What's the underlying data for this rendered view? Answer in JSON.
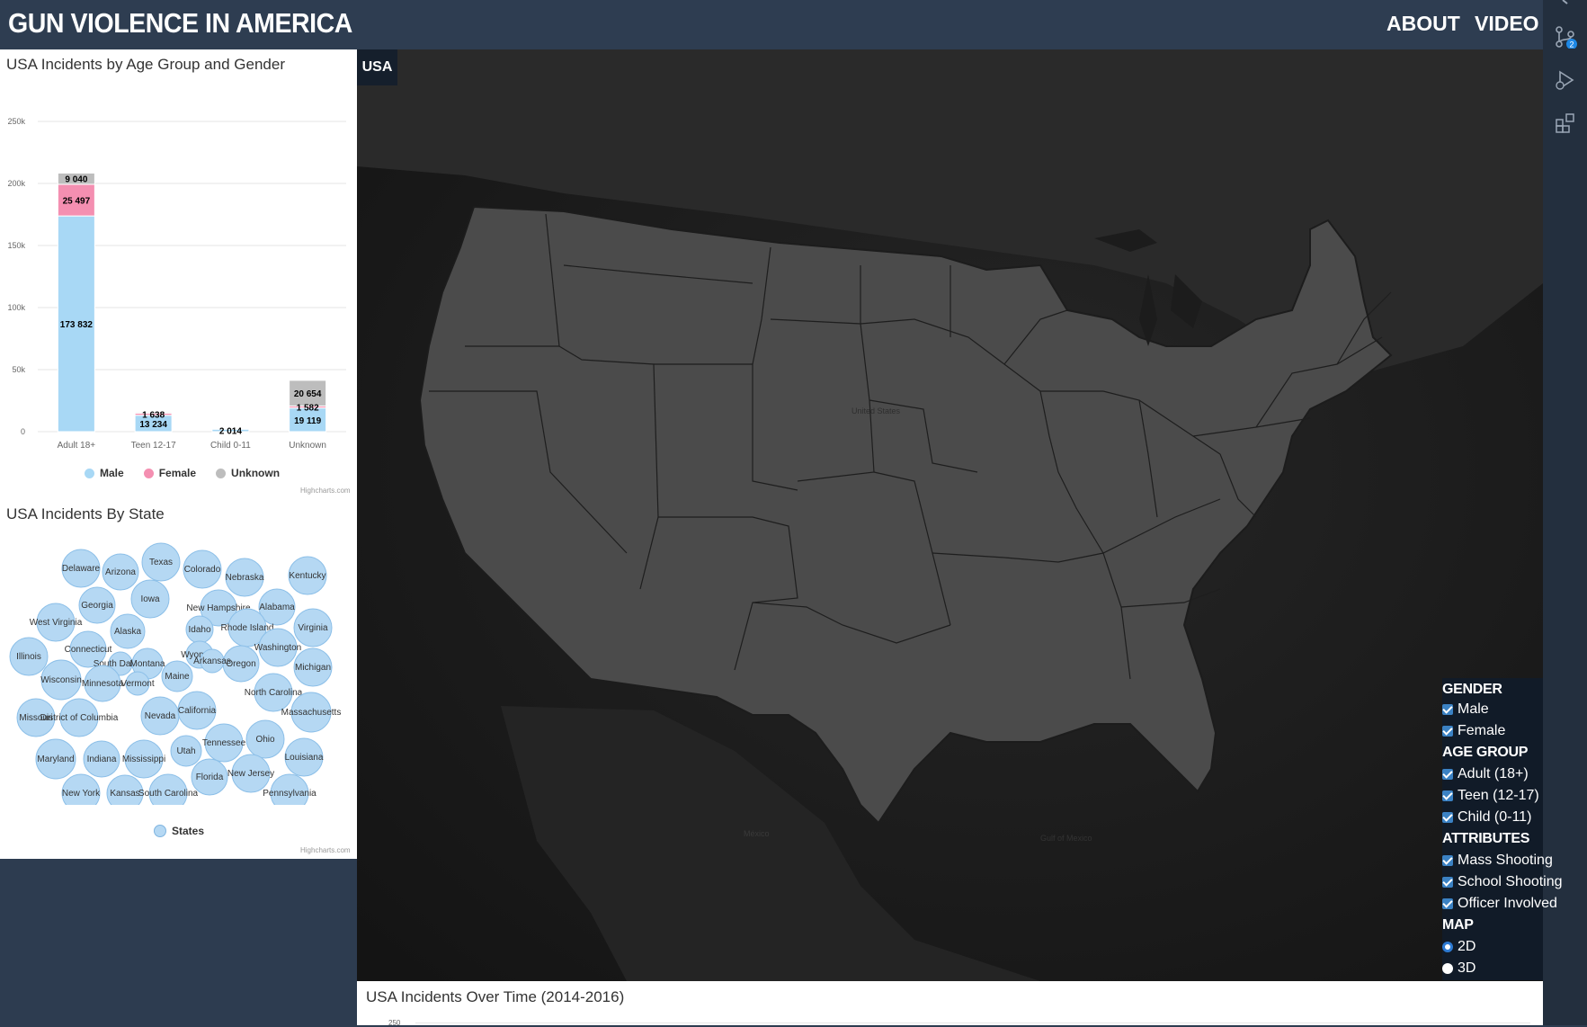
{
  "header": {
    "title": "GUN VIOLENCE IN AMERICA",
    "nav": [
      {
        "label": "ABOUT"
      },
      {
        "label": "VIDEO"
      }
    ]
  },
  "side_rail": {
    "icons": [
      "source-control-icon",
      "run-debug-icon",
      "extensions-icon"
    ],
    "badge": "2"
  },
  "age_chart": {
    "title": "USA Incidents by Age Group and Gender",
    "credits": "Highcharts.com",
    "legend": [
      {
        "label": "Male",
        "color": "#a8d8f5"
      },
      {
        "label": "Female",
        "color": "#f48fb1"
      },
      {
        "label": "Unknown",
        "color": "#bdbdbd"
      }
    ],
    "y_ticks": [
      "0",
      "50k",
      "100k",
      "150k",
      "200k",
      "250k"
    ]
  },
  "chart_data": [
    {
      "type": "bar",
      "title": "USA Incidents by Age Group and Gender",
      "categories": [
        "Adult 18+",
        "Teen 12-17",
        "Child 0-11",
        "Unknown"
      ],
      "series": [
        {
          "name": "Male",
          "values": [
            173832,
            13234,
            2014,
            19119
          ]
        },
        {
          "name": "Female",
          "values": [
            25497,
            1638,
            300,
            1582
          ]
        },
        {
          "name": "Unknown",
          "values": [
            9040,
            800,
            150,
            20654
          ]
        }
      ],
      "data_labels": [
        [
          "173 832",
          "25 497",
          "9 040"
        ],
        [
          "13 234",
          "1 638",
          ""
        ],
        [
          "2 014",
          "",
          ""
        ],
        [
          "19 119",
          "1 582",
          "20 654"
        ]
      ],
      "ylim": [
        0,
        250000
      ],
      "legend": "bottom"
    },
    {
      "type": "bubble",
      "title": "USA Incidents By State",
      "series": [
        {
          "name": "States"
        }
      ],
      "labels": [
        "Delaware",
        "Arizona",
        "Texas",
        "Colorado",
        "Nebraska",
        "Kentucky",
        "Georgia",
        "Iowa",
        "New Hampshire",
        "Alabama",
        "West Virginia",
        "Alaska",
        "Idaho",
        "Rhode Island",
        "Virginia",
        "Illinois",
        "Connecticut",
        "Washington",
        "South Dakota",
        "Montana",
        "Wyoming",
        "Oregon",
        "Michigan",
        "Wisconsin",
        "Minnesota",
        "Vermont",
        "Maine",
        "Arkansas",
        "North Carolina",
        "Missouri",
        "District of Columbia",
        "Nevada",
        "California",
        "Massachusetts",
        "Ohio",
        "Tennessee",
        "Utah",
        "Louisiana",
        "Maryland",
        "Indiana",
        "Mississippi",
        "New Jersey",
        "Florida",
        "New York",
        "Kansas",
        "South Carolina",
        "Pennsylvania"
      ],
      "legend": "bottom"
    },
    {
      "type": "line",
      "title": "USA Incidents Over Time (2014-2016)"
    }
  ],
  "state_chart": {
    "title": "USA Incidents By State",
    "credits": "Highcharts.com",
    "legend_label": "States"
  },
  "map": {
    "badge": "USA",
    "labels": {
      "united_states": "United States",
      "mexico": "México",
      "gulf": "Gulf of Mexico"
    }
  },
  "filters": {
    "gender_head": "GENDER",
    "gender": [
      "Male",
      "Female"
    ],
    "age_head": "AGE GROUP",
    "age": [
      "Adult (18+)",
      "Teen (12-17)",
      "Child (0-11)"
    ],
    "attr_head": "ATTRIBUTES",
    "attributes": [
      "Mass Shooting",
      "School Shooting",
      "Officer Involved"
    ],
    "map_head": "MAP",
    "map_modes": [
      "2D",
      "3D"
    ],
    "map_selected": "2D"
  },
  "timeline": {
    "title": "USA Incidents Over Time (2014-2016)",
    "first_tick": "250"
  }
}
